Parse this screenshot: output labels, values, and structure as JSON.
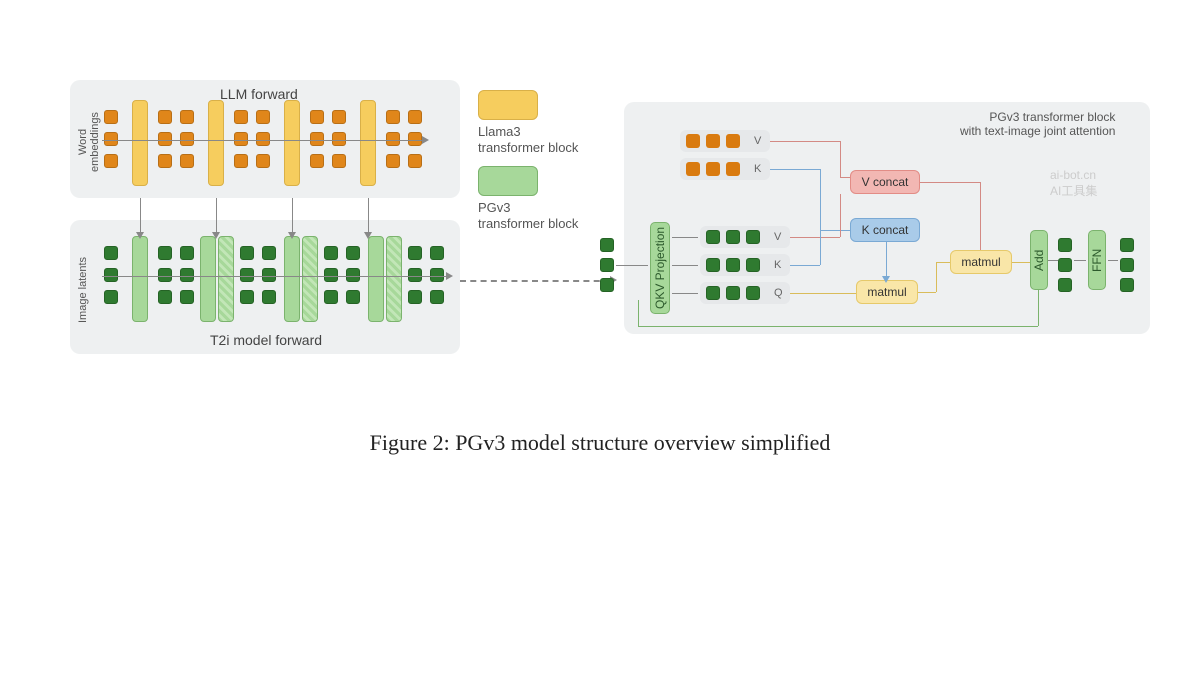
{
  "domain": "Diagram",
  "caption": "Figure 2: PGv3 model structure overview simplified",
  "left": {
    "llm": {
      "title": "LLM forward",
      "ylabel": "Word embeddings",
      "blocks": 4,
      "token_color": "orange",
      "block_color": "yellow"
    },
    "t2i": {
      "title": "T2i model forward",
      "ylabel": "Image latents",
      "blocks": 4,
      "token_color": "dark-green",
      "block_color": "green"
    }
  },
  "legend": {
    "yellow": "Llama3\ntransformer block",
    "green": "PGv3\ntransformer block"
  },
  "right": {
    "title": "PGv3 transformer block\nwith text-image joint attention",
    "qkv_label": "QKV Projection",
    "add_label": "Add",
    "ffn_label": "FFN",
    "rows_image": [
      "V",
      "K",
      "Q"
    ],
    "rows_text": [
      "V",
      "K"
    ],
    "concat_v": "V concat",
    "concat_k": "K concat",
    "matmul1": "matmul",
    "matmul2": "matmul"
  },
  "colors": {
    "orange": "#e0861a",
    "yellow": "#f6cd5e",
    "green": "#a7d89a",
    "dark_green": "#2f7a30",
    "pill_red": "#f2b7b3",
    "pill_blue": "#a9cbe9",
    "pill_yellow": "#f9e6a8",
    "panel_grey": "#eef0f1"
  },
  "watermark": "ai-bot.cn\nAI工具集"
}
